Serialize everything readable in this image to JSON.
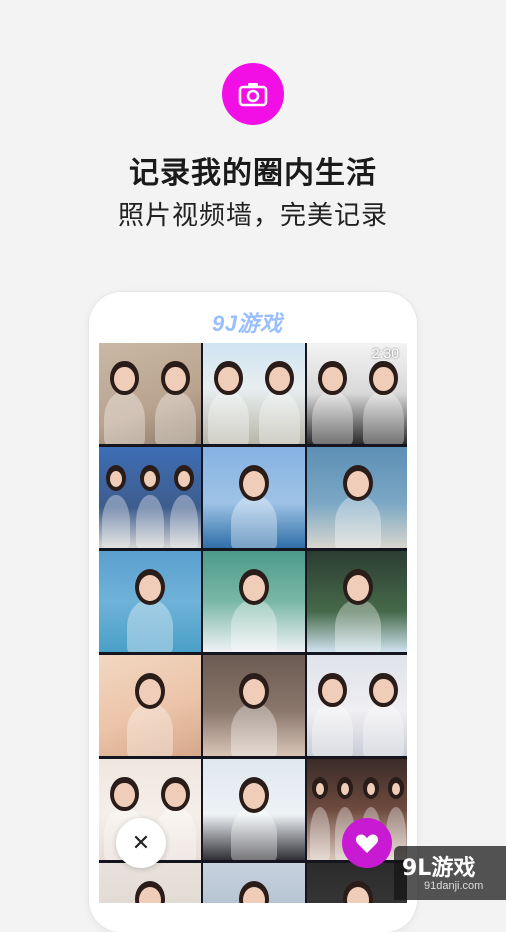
{
  "header": {
    "icon": "camera-icon",
    "accent_color": "#f20fe6",
    "title": "记录我的圈内生活",
    "subtitle": "照片视频墙，完美记录"
  },
  "phone": {
    "status_time": "2:30",
    "photo_grid": {
      "columns": 3,
      "tiles": [
        {
          "bg": "linear-gradient(160deg,#c9b9a6,#b9a38e 60%,#8e7d6a)",
          "people": 2
        },
        {
          "bg": "linear-gradient(180deg,#cfe4f2,#e8eef0 45%,#b8b6a8)",
          "people": 2
        },
        {
          "bg": "linear-gradient(180deg,#f3f3f3,#d8d8d8 50%,#2a2a2a)",
          "people": 2
        },
        {
          "bg": "linear-gradient(180deg,#3d6db5,#3e5d8d 60%,#d5d5d5)",
          "people": 3
        },
        {
          "bg": "linear-gradient(180deg,#86b2e2,#9ec3e6 55%,#2f6fa8)",
          "people": 1
        },
        {
          "bg": "linear-gradient(180deg,#5d8fb5,#7aa7c4 55%,#d8d6ce)",
          "people": 1
        },
        {
          "bg": "linear-gradient(180deg,#5b9fd0,#6fb2d8 50%,#4aa0c8)",
          "people": 1
        },
        {
          "bg": "linear-gradient(180deg,#4d9a8a,#7ab8a6 50%,#f0f2f5)",
          "people": 1
        },
        {
          "bg": "linear-gradient(180deg,#2c3d32,#466a4a 60%,#cfe3ee)",
          "people": 1
        },
        {
          "bg": "linear-gradient(160deg,#f2d7c1,#ecc4a9 55%,#d6a88a)",
          "people": 1
        },
        {
          "bg": "linear-gradient(180deg,#6b5b52,#8a776c 55%,#d8c5b8)",
          "people": 1
        },
        {
          "bg": "linear-gradient(180deg,#dfe3ea,#f0eff2 55%,#c9ccd6)",
          "people": 2
        },
        {
          "bg": "linear-gradient(180deg,#f0e6e0,#f5efe9 55%,#e8dcd6)",
          "people": 2
        },
        {
          "bg": "linear-gradient(180deg,#dfe8f0,#eef2f5 55%,#2f2f35)",
          "people": 1
        },
        {
          "bg": "linear-gradient(180deg,#3a2c28,#6e4a3e 50%,#d9c8bd)",
          "people": 4
        },
        {
          "bg": "linear-gradient(180deg,#e9e2dc,#d8cfc8)",
          "people": 1
        },
        {
          "bg": "linear-gradient(180deg,#c7d2de,#9fb0c2)",
          "people": 1
        },
        {
          "bg": "linear-gradient(180deg,#2b2b2b,#444444)",
          "people": 1
        }
      ]
    },
    "watermark_mid": "9J游戏",
    "close_button": {
      "icon": "close-icon",
      "symbol": "✕"
    },
    "like_button": {
      "icon": "heart-icon",
      "color": "#c81ad2"
    }
  },
  "site_watermark": {
    "logo": "9L游戏",
    "url": "91danji.com"
  }
}
